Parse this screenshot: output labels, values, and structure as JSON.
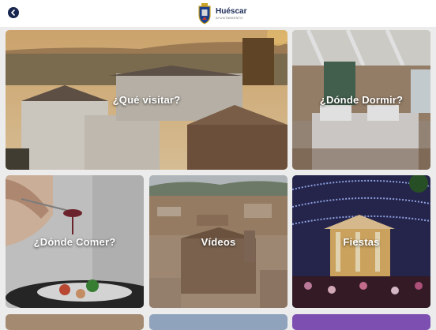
{
  "header": {
    "back_icon": "chevron-left-icon",
    "logo_icon": "coat-of-arms-icon",
    "logo_name": "Huéscar",
    "logo_subtitle": "AYUNTAMIENTO"
  },
  "tiles": [
    {
      "label": "¿Qué visitar?"
    },
    {
      "label": "¿Dónde Dormir?"
    },
    {
      "label": "¿Dónde Comer?"
    },
    {
      "label": "Vídeos"
    },
    {
      "label": "Fiestas"
    }
  ],
  "colors": {
    "accent": "#17264f",
    "background": "#ececec"
  }
}
